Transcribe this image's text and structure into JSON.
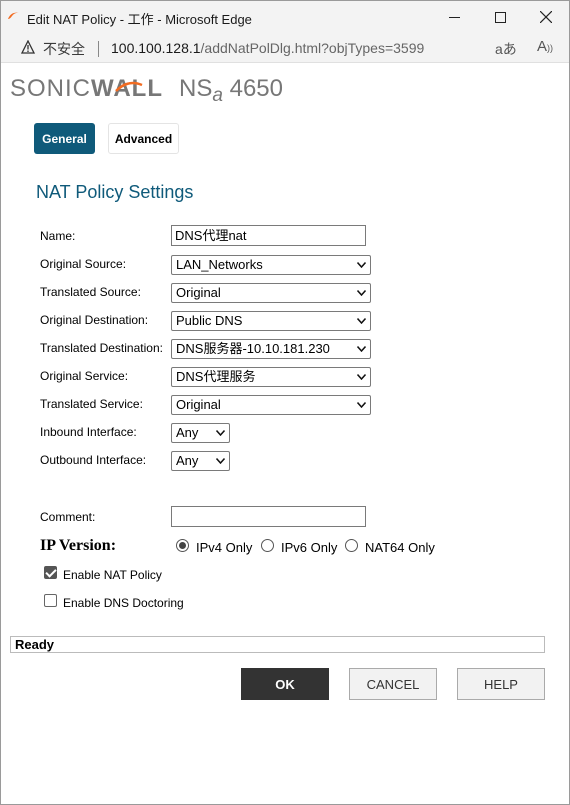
{
  "window": {
    "title": "Edit NAT Policy - 工作 - Microsoft Edge",
    "address": {
      "security_label": "不安全",
      "url_host": "100.100.128.1",
      "url_path": "/addNatPolDlg.html?objTypes=3599"
    }
  },
  "brand": {
    "sonic": "SONIC",
    "wall": "WALL",
    "model_prefix": "NS",
    "model_sub": "a",
    "model_number": "4650"
  },
  "tabs": {
    "general": "General",
    "advanced": "Advanced"
  },
  "section_title": "NAT Policy Settings",
  "form": {
    "name_label": "Name:",
    "name_value": "DNS代理nat",
    "original_source_label": "Original Source:",
    "original_source_value": "LAN_Networks",
    "translated_source_label": "Translated Source:",
    "translated_source_value": "Original",
    "original_destination_label": "Original Destination:",
    "original_destination_value": "Public DNS",
    "translated_destination_label": "Translated Destination:",
    "translated_destination_value": "DNS服务器-10.10.181.230",
    "original_service_label": "Original Service:",
    "original_service_value": "DNS代理服务",
    "translated_service_label": "Translated Service:",
    "translated_service_value": "Original",
    "inbound_interface_label": "Inbound Interface:",
    "inbound_interface_value": "Any",
    "outbound_interface_label": "Outbound Interface:",
    "outbound_interface_value": "Any",
    "comment_label": "Comment:",
    "comment_value": "",
    "ip_version_label": "IP Version:",
    "ip_options": [
      "IPv4 Only",
      "IPv6 Only",
      "NAT64 Only"
    ],
    "ip_selected": "IPv4 Only",
    "enable_nat_label": "Enable NAT Policy",
    "enable_nat_checked": true,
    "enable_dns_doctoring_label": "Enable DNS Doctoring",
    "enable_dns_doctoring_checked": false
  },
  "status": "Ready",
  "buttons": {
    "ok": "OK",
    "cancel": "CANCEL",
    "help": "HELP"
  },
  "colors": {
    "accent": "#0f5a7a",
    "brand_orange": "#f26b21",
    "ok_button": "#333333"
  },
  "icons": {
    "warning": "warning-icon",
    "read_aloud": "read-aloud-icon",
    "immersive_reader": "immersive-reader-icon"
  }
}
